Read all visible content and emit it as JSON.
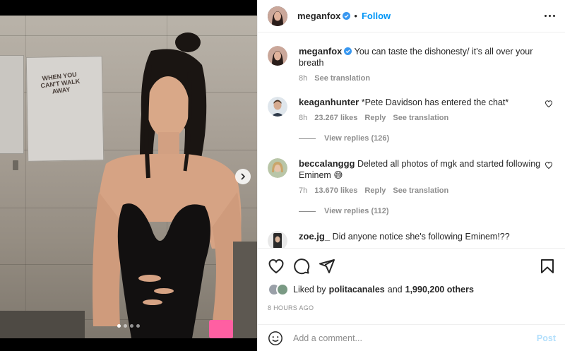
{
  "post": {
    "author": "meganfox",
    "follow_label": "Follow",
    "caption_user": "meganfox",
    "caption_text": "You can taste the dishonesty/ it's all over your breath",
    "caption_time": "8h",
    "see_translation": "See translation"
  },
  "poster": {
    "text": "WHEN YOU CAN'T WALK AWAY"
  },
  "comments": [
    {
      "user": "keaganhunter",
      "text": "*Pete Davidson has entered the chat*",
      "time": "8h",
      "likes": "23.267 likes",
      "reply": "Reply",
      "translate": "See translation",
      "view_replies": "View replies (126)"
    },
    {
      "user": "beccalanggg",
      "text": "Deleted all photos of mgk and started following Eminem 😅",
      "time": "7h",
      "likes": "13.670 likes",
      "reply": "Reply",
      "translate": "See translation",
      "view_replies": "View replies (112)"
    },
    {
      "user": "zoe.jg_",
      "text": "Did anyone notice she's following Eminem!??"
    }
  ],
  "likes": {
    "prefix": "Liked by",
    "user": "politacanales",
    "and": "and",
    "count": "1,990,200 others"
  },
  "timestamp": "8 HOURS AGO",
  "comment_box": {
    "placeholder": "Add a comment...",
    "post_label": "Post"
  },
  "carousel": {
    "total": 4,
    "active": 1
  },
  "colors": {
    "accent": "#0095f6",
    "verified": "#3897f0",
    "post_disabled": "#b2dffc"
  },
  "icons": [
    "verified-badge-icon",
    "more-options-icon",
    "heart-icon",
    "comment-icon",
    "share-icon",
    "bookmark-icon",
    "emoji-icon",
    "chevron-right-icon"
  ]
}
